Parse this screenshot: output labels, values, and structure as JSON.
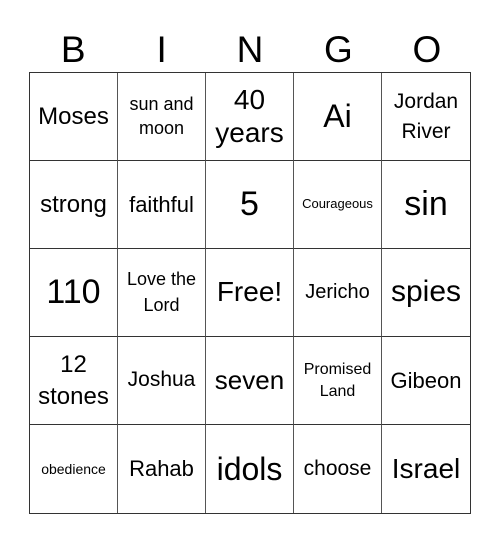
{
  "header": [
    "B",
    "I",
    "N",
    "G",
    "O"
  ],
  "cells": [
    "Moses",
    "sun and moon",
    "40 years",
    "Ai",
    "Jordan River",
    "strong",
    "faithful",
    "5",
    "Courageous",
    "sin",
    "110",
    "Love the Lord",
    "Free!",
    "Jericho",
    "spies",
    "12 stones",
    "Joshua",
    "seven",
    "Promised Land",
    "Gibeon",
    "obedience",
    "Rahab",
    "idols",
    "choose",
    "Israel"
  ]
}
